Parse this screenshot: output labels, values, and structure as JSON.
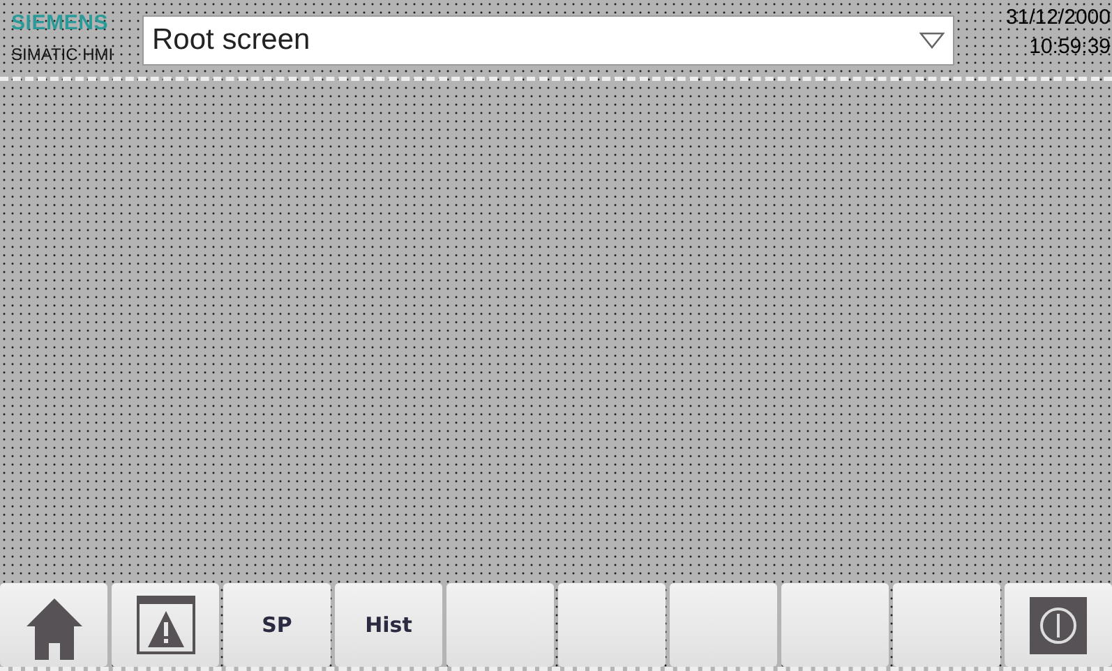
{
  "header": {
    "brand": "SIEMENS",
    "product": "SIMATIC HMI",
    "screen_selector": {
      "value": "Root screen"
    },
    "date": "31/12/2000",
    "time": "10:59:39"
  },
  "buttons": [
    {
      "kind": "home"
    },
    {
      "kind": "alarm"
    },
    {
      "kind": "text",
      "label": "SP"
    },
    {
      "kind": "text",
      "label": "Hist"
    },
    {
      "kind": "empty"
    },
    {
      "kind": "empty"
    },
    {
      "kind": "empty"
    },
    {
      "kind": "empty"
    },
    {
      "kind": "empty"
    },
    {
      "kind": "power"
    }
  ]
}
